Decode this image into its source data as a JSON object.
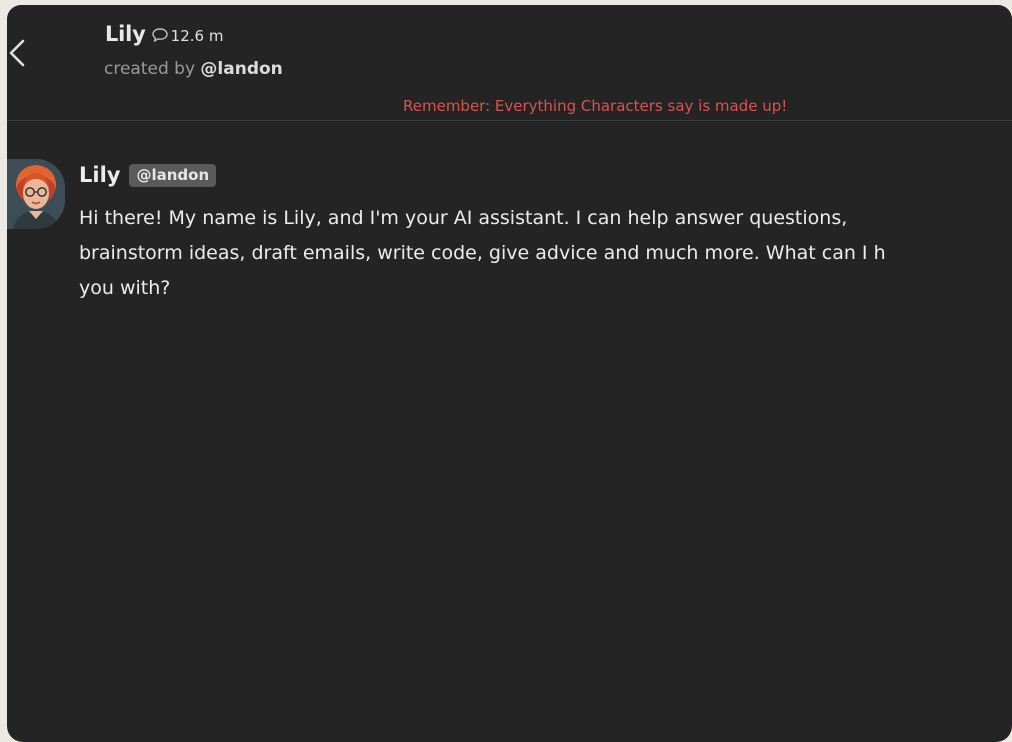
{
  "header": {
    "character_name": "Lily",
    "chat_count": "12.6 m",
    "created_by_prefix": "created by",
    "creator_handle": "@landon",
    "disclaimer": "Remember: Everything Characters say is made up!"
  },
  "icons": {
    "back": "chevron-left-icon",
    "chat": "chat-bubble-icon",
    "avatar": "avatar"
  },
  "message": {
    "author": "Lily",
    "author_tag": "@landon",
    "lines": [
      "Hi there! My name is Lily, and I'm your AI assistant. I can help answer questions,",
      "brainstorm ideas, draft emails, write code, give advice and much more. What can I h",
      "you with?"
    ]
  },
  "colors": {
    "background": "#242424",
    "outer": "#ece9e4",
    "disclaimer": "#d9534f",
    "tag_bg": "#5a5a5a"
  }
}
